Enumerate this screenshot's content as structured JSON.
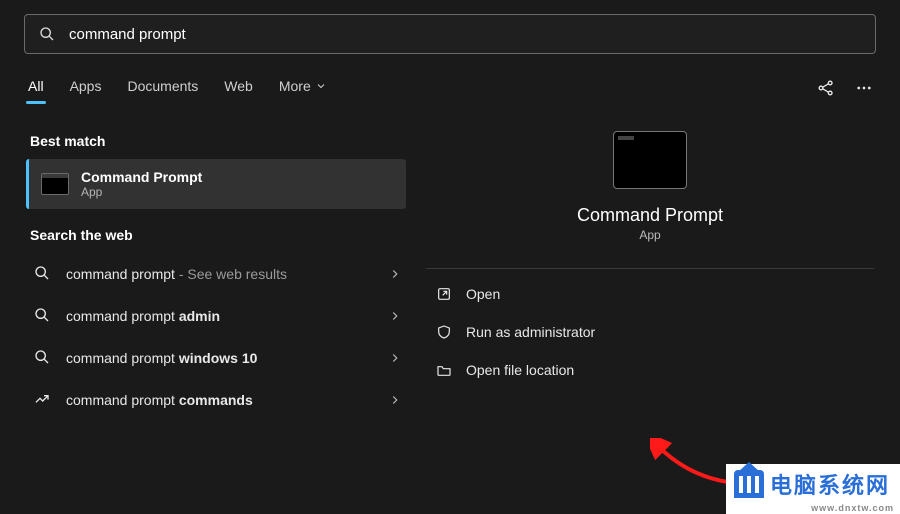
{
  "search": {
    "query": "command prompt"
  },
  "tabs": {
    "items": [
      "All",
      "Apps",
      "Documents",
      "Web",
      "More"
    ],
    "active": 0
  },
  "bestMatch": {
    "label": "Best match",
    "title": "Command Prompt",
    "subtitle": "App"
  },
  "searchWeb": {
    "label": "Search the web",
    "items": [
      {
        "prefix": "command prompt",
        "bold": "",
        "hint": " - See web results"
      },
      {
        "prefix": "command prompt ",
        "bold": "admin",
        "hint": ""
      },
      {
        "prefix": "command prompt ",
        "bold": "windows 10",
        "hint": ""
      },
      {
        "prefix": "command prompt ",
        "bold": "commands",
        "hint": ""
      }
    ]
  },
  "detail": {
    "title": "Command Prompt",
    "subtitle": "App",
    "actions": [
      {
        "icon": "open",
        "label": "Open"
      },
      {
        "icon": "shield",
        "label": "Run as administrator"
      },
      {
        "icon": "folder",
        "label": "Open file location"
      }
    ]
  },
  "watermark": {
    "text": "电脑系统网",
    "url": "www.dnxtw.com"
  }
}
